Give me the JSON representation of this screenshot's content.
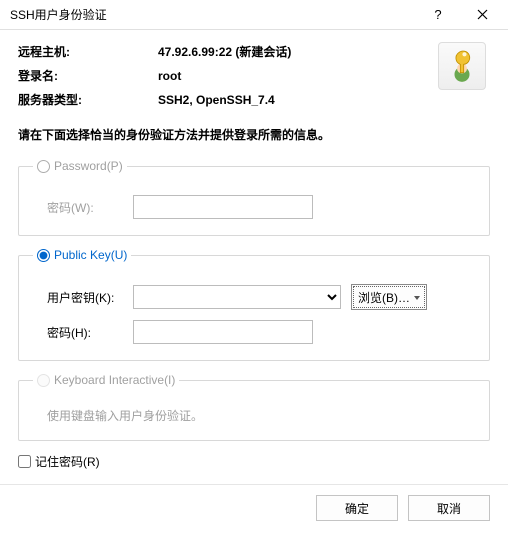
{
  "titlebar": {
    "title": "SSH用户身份验证"
  },
  "info": {
    "labels": {
      "host": "远程主机:",
      "login": "登录名:",
      "server": "服务器类型:"
    },
    "values": {
      "host": "47.92.6.99:22 (新建会话)",
      "login": "root",
      "server": "SSH2, OpenSSH_7.4"
    }
  },
  "instruction": "请在下面选择恰当的身份验证方法并提供登录所需的信息。",
  "password": {
    "legend": "Password(P)",
    "label": "密码(W):"
  },
  "publickey": {
    "legend": "Public Key(U)",
    "keylabel": "用户密钥(K):",
    "passlabel": "密码(H):",
    "browse": "浏览(B)…"
  },
  "keyboard": {
    "legend": "Keyboard Interactive(I)",
    "hint": "使用键盘输入用户身份验证。"
  },
  "remember": "记住密码(R)",
  "footer": {
    "ok": "确定",
    "cancel": "取消"
  }
}
